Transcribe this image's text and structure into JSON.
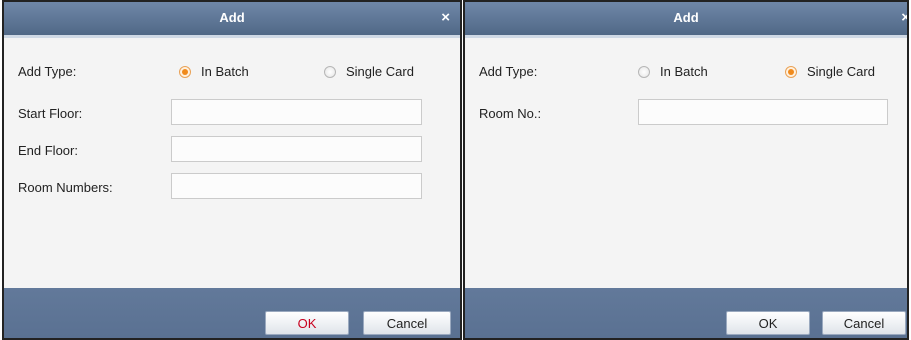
{
  "left_dialog": {
    "title": "Add",
    "close_glyph": "×",
    "add_type_label": "Add Type:",
    "options": [
      {
        "label": "In Batch",
        "selected": true
      },
      {
        "label": "Single Card",
        "selected": false
      }
    ],
    "fields": [
      {
        "label": "Start Floor:",
        "value": ""
      },
      {
        "label": "End Floor:",
        "value": ""
      },
      {
        "label": "Room Numbers:",
        "value": ""
      }
    ],
    "ok_label": "OK",
    "cancel_label": "Cancel"
  },
  "right_dialog": {
    "title": "Add",
    "close_glyph": "×",
    "add_type_label": "Add Type:",
    "options": [
      {
        "label": "In Batch",
        "selected": false
      },
      {
        "label": "Single Card",
        "selected": true
      }
    ],
    "fields": [
      {
        "label": "Room No.:",
        "value": ""
      }
    ],
    "ok_label": "OK",
    "cancel_label": "Cancel"
  },
  "colors": {
    "titlebar": "#5e7699",
    "footer": "#5e7699",
    "radio_selected": "#f08a1c",
    "ok_text_left": "#c8001e"
  }
}
